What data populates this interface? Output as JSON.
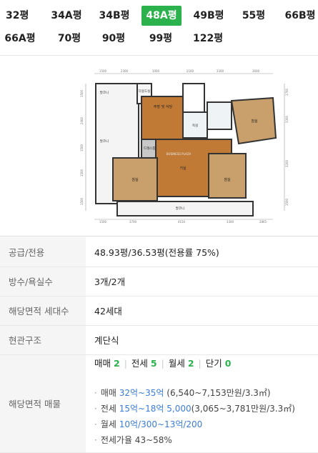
{
  "tabs": [
    {
      "label": "32평",
      "active": false
    },
    {
      "label": "34A평",
      "active": false
    },
    {
      "label": "34B평",
      "active": false
    },
    {
      "label": "48A평",
      "active": true
    },
    {
      "label": "49B평",
      "active": false
    },
    {
      "label": "55평",
      "active": false
    },
    {
      "label": "66B평",
      "active": false
    },
    {
      "label": "66A평",
      "active": false
    },
    {
      "label": "70평",
      "active": false
    },
    {
      "label": "90평",
      "active": false
    },
    {
      "label": "99평",
      "active": false
    },
    {
      "label": "122평",
      "active": false
    }
  ],
  "floorplan": {
    "top_dims": [
      "1500",
      "2300",
      "3000",
      "2160",
      "3300",
      "3600"
    ],
    "bottom_dims": [
      "1500",
      "3700",
      "4150",
      "3300",
      "2865"
    ],
    "left_dims": [
      "1500",
      "2400",
      "1500",
      "1500",
      "1500"
    ],
    "right_dims": [
      "1700",
      "3300",
      "3200",
      "1500"
    ],
    "rooms": {
      "laundry": "다용도실",
      "kitchen": "주방 및 식당",
      "dress": "드레스룸",
      "living": "거실",
      "bedroom_left": "침실",
      "bedroom_right": "침실",
      "bedroom_top_right": "침실",
      "balcony": "발코니",
      "toilet": "욕실"
    },
    "watermark": "BUSINESS PLAZA"
  },
  "info": {
    "supply_label": "공급/전용",
    "supply_value": "48.93평/36.53평(전용률 75%)",
    "rooms_label": "방수/욕실수",
    "rooms_value": "3개/2개",
    "households_label": "해당면적 세대수",
    "households_value": "42세대",
    "entrance_label": "현관구조",
    "entrance_value": "계단식",
    "listings_label": "해당면적 매물"
  },
  "listings": {
    "counts": [
      {
        "label": "매매",
        "count": "2"
      },
      {
        "label": "전세",
        "count": "5"
      },
      {
        "label": "월세",
        "count": "2"
      },
      {
        "label": "단기",
        "count": "0"
      }
    ],
    "sale": {
      "label": "매매",
      "range": "32억~35억",
      "detail": "(6,540~7,153만원/3.3㎡)"
    },
    "jeonse": {
      "label": "전세",
      "range": "15억~18억 5,000",
      "detail": "(3,065~3,781만원/3.3㎡)"
    },
    "monthly": {
      "label": "월세",
      "range": "10억/300~13억/200"
    },
    "ratio": {
      "label": "전세가율 43~58%"
    }
  },
  "colors": {
    "accent": "#2bb24c",
    "link": "#3b7dd8"
  }
}
